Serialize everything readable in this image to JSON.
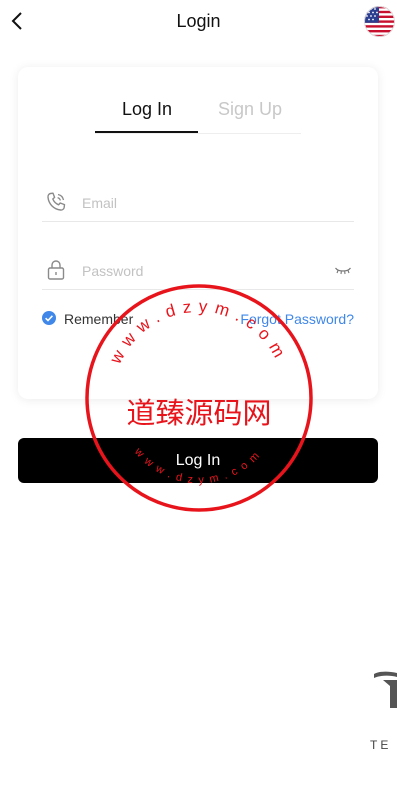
{
  "header": {
    "title": "Login",
    "back_icon": "chevron-left-icon",
    "language_icon": "us-flag-icon"
  },
  "tabs": [
    {
      "label": "Log In",
      "active": true
    },
    {
      "label": "Sign Up",
      "active": false
    }
  ],
  "form": {
    "email": {
      "placeholder": "Email",
      "value": "",
      "icon": "phone-icon"
    },
    "password": {
      "placeholder": "Password",
      "value": "",
      "icon": "lock-icon",
      "toggle_icon": "eye-closed-icon"
    },
    "remember": {
      "label": "Remember",
      "checked": true
    },
    "forgot_label": "Forgot Password?"
  },
  "submit_label": "Log In",
  "watermark": {
    "center_text": "道臻源码网",
    "ring_top": "www.dzym.com",
    "ring_bottom": "www.dzym.com"
  },
  "brand": {
    "wordmark": "TE"
  },
  "colors": {
    "accent_blue": "#3f87e8",
    "button_bg": "#000000",
    "stamp_red": "#e8141c",
    "inactive_tab": "#c8c8c8"
  }
}
